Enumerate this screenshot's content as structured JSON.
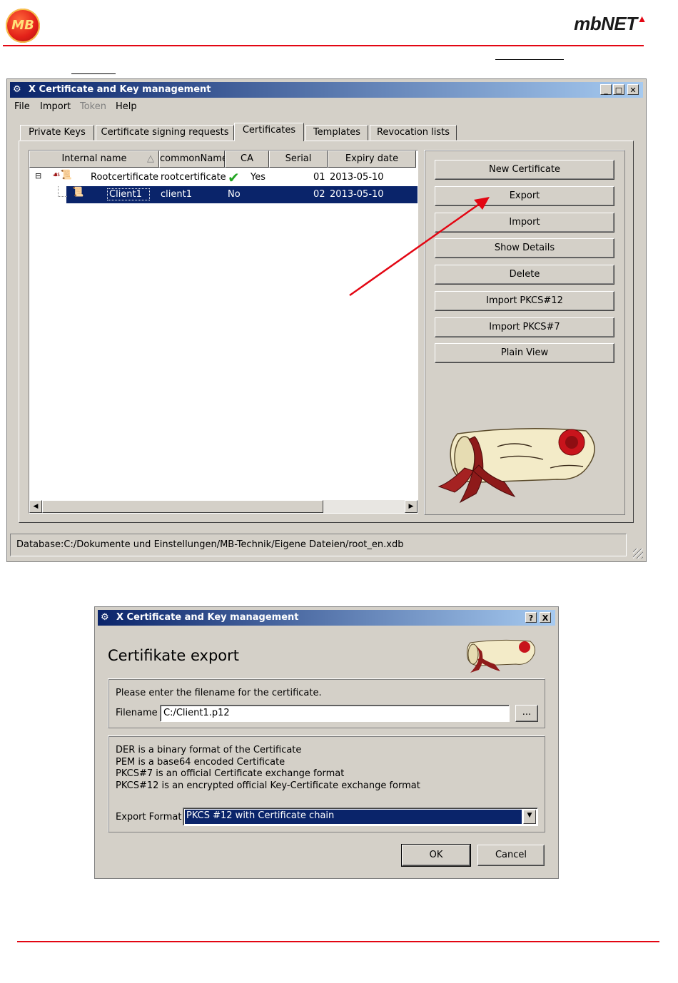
{
  "page": {
    "logo_left": "MB",
    "logo_right": "mbNET"
  },
  "main_window": {
    "title": "X Certificate and Key management",
    "menu": [
      "File",
      "Import",
      "Token",
      "Help"
    ],
    "tabs": [
      "Private Keys",
      "Certificate signing requests",
      "Certificates",
      "Templates",
      "Revocation lists"
    ],
    "active_tab": "Certificates",
    "columns": [
      "Internal name",
      "commonName",
      "CA",
      "Serial",
      "Expiry date"
    ],
    "rows": [
      {
        "internal_name": "Rootcertificate",
        "common_name": "rootcertificate",
        "ca": "Yes",
        "serial": "01",
        "expiry": "2013-05-10"
      },
      {
        "internal_name": "Client1",
        "common_name": "client1",
        "ca": "No",
        "serial": "02",
        "expiry": "2013-05-10"
      }
    ],
    "buttons": [
      "New Certificate",
      "Export",
      "Import",
      "Show Details",
      "Delete",
      "Import PKCS#12",
      "Import PKCS#7",
      "Plain View"
    ],
    "status": "Database:C:/Dokumente und Einstellungen/MB-Technik/Eigene Dateien/root_en.xdb",
    "colors": {
      "selection": "#0a246a",
      "arrow": "#e30613",
      "accent_line": "#e30613"
    }
  },
  "export_dialog": {
    "title": "X Certificate and Key management",
    "heading": "Certifikate export",
    "prompt": "Please enter the filename for the certificate.",
    "filename_label": "Filename",
    "filename_value": "C:/Client1.p12",
    "browse_label": "...",
    "info_lines": [
      "DER is a binary format of the Certificate",
      "PEM is a base64 encoded Certificate",
      "PKCS#7 is an official Certificate exchange format",
      "PKCS#12 is an encrypted official Key-Certificate exchange format"
    ],
    "format_label": "Export Format",
    "format_value": "PKCS #12 with Certificate chain",
    "ok_label": "OK",
    "cancel_label": "Cancel",
    "help_label": "?",
    "close_label": "X"
  }
}
